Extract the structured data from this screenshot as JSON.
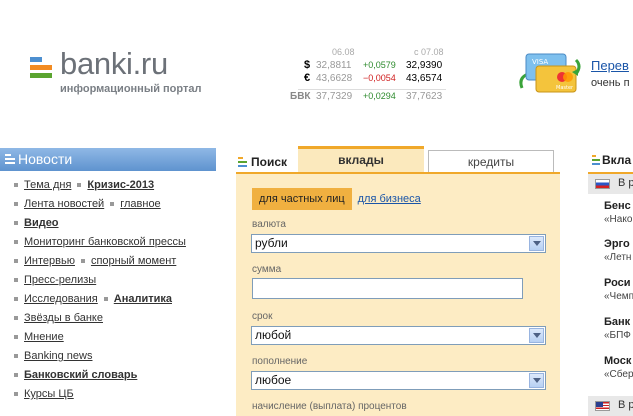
{
  "header": {
    "logo": {
      "name": "banki.ru",
      "tagline": "информационный портал"
    },
    "rates": {
      "date_prev": "06.08",
      "date_next": "с 07.08",
      "rows": [
        {
          "symbol": "$",
          "prev": "32,8811",
          "change": "+0,0579",
          "next": "32,9390",
          "dir": "up"
        },
        {
          "symbol": "€",
          "prev": "43,6628",
          "change": "−0,0054",
          "next": "43,6574",
          "dir": "down"
        },
        {
          "symbol": "БВК",
          "prev": "37,7329",
          "change": "+0,0294",
          "next": "37,7623",
          "dir": "up"
        }
      ]
    },
    "promo": {
      "title": "Перев",
      "subtitle": "очень п",
      "card_labels": [
        "VISA",
        "Master"
      ]
    }
  },
  "news": {
    "title": "Новости",
    "items": [
      [
        {
          "text": "Тема дня",
          "bold": false
        },
        {
          "text": "Кризис-2013",
          "bold": true
        }
      ],
      [
        {
          "text": "Лента новостей",
          "bold": false
        },
        {
          "text": "главное",
          "bold": false
        }
      ],
      [
        {
          "text": "Видео",
          "bold": true
        }
      ],
      [
        {
          "text": "Мониторинг банковской прессы",
          "bold": false
        }
      ],
      [
        {
          "text": "Интервью",
          "bold": false
        },
        {
          "text": "спорный момент",
          "bold": false
        }
      ],
      [
        {
          "text": "Пресс-релизы",
          "bold": false
        }
      ],
      [
        {
          "text": "Исследования",
          "bold": false
        },
        {
          "text": "Аналитика",
          "bold": true
        }
      ],
      [
        {
          "text": "Звёзды в банке",
          "bold": false
        }
      ],
      [
        {
          "text": "Мнение",
          "bold": false
        }
      ],
      [
        {
          "text": "Banking news",
          "bold": false
        }
      ],
      [
        {
          "text": "Банковский словарь",
          "bold": true
        }
      ],
      [
        {
          "text": "Курсы ЦБ",
          "bold": false
        }
      ]
    ]
  },
  "search": {
    "tab_search": "Поиск",
    "tab_deposits": "вклады",
    "tab_credits": "кредиты",
    "segment_active": "для частных лиц",
    "segment_inactive": "для бизнеса",
    "fields": {
      "currency": {
        "label": "валюта",
        "value": "рубли"
      },
      "amount": {
        "label": "сумма",
        "value": ""
      },
      "term": {
        "label": "срок",
        "value": "любой"
      },
      "topup": {
        "label": "пополнение",
        "value": "любое"
      },
      "interest": {
        "label": "начисление (выплата) процентов"
      }
    }
  },
  "deposits": {
    "title": "Вкла",
    "country_top": "В р",
    "country_bottom": "В р",
    "banks": [
      {
        "name": "Бенс",
        "desc": "«Нако"
      },
      {
        "name": "Эрго",
        "desc": "«Летн"
      },
      {
        "name": "Роси",
        "desc": "«Чемп"
      },
      {
        "name": "Банк",
        "desc": "«БПФ +"
      },
      {
        "name": "Моск",
        "desc": "«Сбере"
      }
    ]
  },
  "colors": {
    "accent": "#f0a82a",
    "panel": "#fdecc4",
    "news_header": "#6b9fd8",
    "link": "#1a55a8"
  }
}
